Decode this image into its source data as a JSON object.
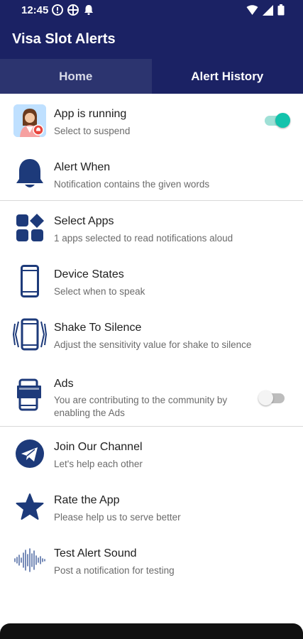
{
  "status": {
    "time": "12:45"
  },
  "app": {
    "title": "Visa Slot Alerts"
  },
  "tabs": [
    {
      "label": "Home",
      "selected": true
    },
    {
      "label": "Alert History",
      "selected": false
    }
  ],
  "items": [
    {
      "title": "App is running",
      "subtitle": "Select to suspend",
      "icon": "avatar-icon",
      "toggle": "on"
    },
    {
      "title": "Alert When",
      "subtitle": "Notification contains the given words",
      "icon": "bell-icon"
    },
    {
      "title": "Select Apps",
      "subtitle": "1 apps selected to read notifications aloud",
      "icon": "apps-grid-icon"
    },
    {
      "title": "Device States",
      "subtitle": "Select when to speak",
      "icon": "phone-icon"
    },
    {
      "title": "Shake To Silence",
      "subtitle": "Adjust the sensitivity value for shake to silence",
      "icon": "shake-phone-icon"
    },
    {
      "title": "Ads",
      "subtitle": "You are contributing to the community by enabling the Ads",
      "icon": "ads-phone-icon",
      "toggle": "off"
    },
    {
      "title": "Join Our Channel",
      "subtitle": "Let's help each other",
      "icon": "telegram-icon"
    },
    {
      "title": "Rate the App",
      "subtitle": "Please help us to serve better",
      "icon": "star-icon"
    },
    {
      "title": "Test Alert Sound",
      "subtitle": "Post a notification for testing",
      "icon": "sound-wave-icon"
    }
  ],
  "colors": {
    "primary": "#1b2264",
    "accent": "#13c3ac",
    "icon": "#1d3a7a"
  }
}
